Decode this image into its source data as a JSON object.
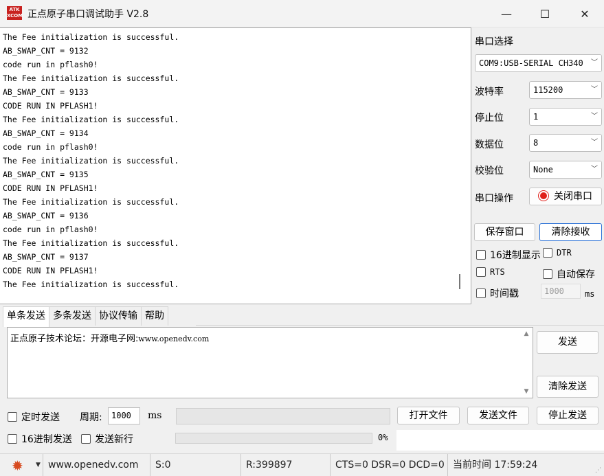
{
  "window": {
    "logo_text": "ATK\nXCOM",
    "title": "正点原子串口调试助手 V2.8",
    "min_glyph": "—",
    "max_glyph": "☐",
    "close_glyph": "✕"
  },
  "receive": {
    "lines": [
      "The Fee initialization is successful.",
      "AB_SWAP_CNT = 9132",
      "code run in pflash0!",
      "The Fee initialization is successful.",
      "AB_SWAP_CNT = 9133",
      "CODE RUN IN PFLASH1!",
      "The Fee initialization is successful.",
      "AB_SWAP_CNT = 9134",
      "code run in pflash0!",
      "The Fee initialization is successful.",
      "AB_SWAP_CNT = 9135",
      "CODE RUN IN PFLASH1!",
      "The Fee initialization is successful.",
      "AB_SWAP_CNT = 9136",
      "code run in pflash0!",
      "The Fee initialization is successful.",
      "AB_SWAP_CNT = 9137",
      "CODE RUN IN PFLASH1!",
      "The Fee initialization is successful."
    ]
  },
  "panel": {
    "port_select_label": "串口选择",
    "port_value": "COM9:USB-SERIAL CH340",
    "baud_label": "波特率",
    "baud_value": "115200",
    "stopbits_label": "停止位",
    "stopbits_value": "1",
    "databits_label": "数据位",
    "databits_value": "8",
    "parity_label": "校验位",
    "parity_value": "None",
    "port_op_label": "串口操作",
    "close_port_button": "关闭串口",
    "save_window_button": "保存窗口",
    "clear_receive_button": "清除接收",
    "hex_display_label": "16进制显示",
    "dtr_label": "DTR",
    "rts_label": "RTS",
    "auto_save_label": "自动保存",
    "timestamp_label": "时间戳",
    "timestamp_value": "1000",
    "ms_label": "ms",
    "dropdown_glyph": "﹀",
    "status_color": "#e0201a"
  },
  "tabs": [
    "单条发送",
    "多条发送",
    "协议传输",
    "帮助"
  ],
  "send": {
    "text_cn": "正点原子技术论坛：开源电子网:",
    "text_url": "www.openedv.com",
    "send_button": "发送",
    "clear_send_button": "清除发送",
    "scroll_up": "▲",
    "scroll_down": "▼"
  },
  "bottom": {
    "timed_send_label": "定时发送",
    "period_label": "周期:",
    "period_value": "1000",
    "period_unit": "ms",
    "open_file_button": "打开文件",
    "send_file_button": "发送文件",
    "stop_send_button": "停止发送",
    "hex_send_label": "16进制发送",
    "send_newline_label": "发送新行",
    "progress_text": "0%",
    "progress_value": 0
  },
  "statusbar": {
    "gear_glyph": "✹",
    "caret_glyph": "▼",
    "website": "www.openedv.com",
    "sent": "S:0",
    "received": "R:399897",
    "signals": "CTS=0 DSR=0 DCD=0",
    "current_time": "当前时间 17:59:24",
    "grip_glyph": "⋰"
  }
}
